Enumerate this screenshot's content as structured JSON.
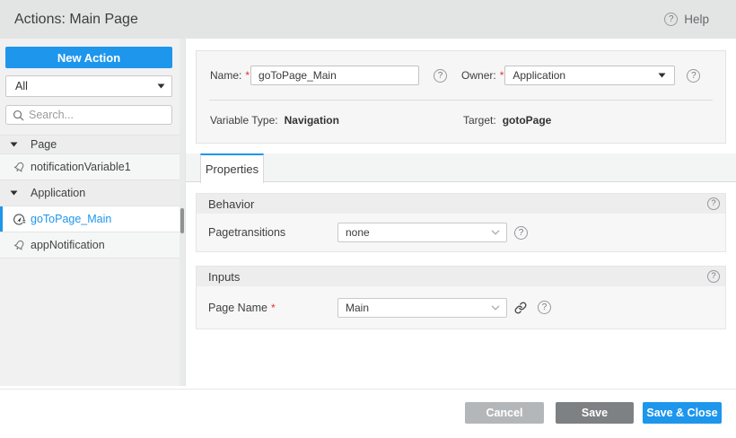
{
  "colors": {
    "accent_blue": "#1e96ec",
    "save_gray": "#7d8183",
    "cancel_gray": "#b4b7b9",
    "required_red": "#e5322d"
  },
  "header": {
    "title": "Actions: Main Page",
    "help_label": "Help"
  },
  "sidebar": {
    "new_action_label": "New Action",
    "filter_value": "All",
    "search_placeholder": "Search...",
    "tree": [
      {
        "label": "Page",
        "type": "group",
        "expanded": true
      },
      {
        "label": "notificationVariable1",
        "type": "notification",
        "selected": false
      },
      {
        "label": "Application",
        "type": "group",
        "expanded": true
      },
      {
        "label": "goToPage_Main",
        "type": "navigate",
        "selected": true
      },
      {
        "label": "appNotification",
        "type": "notification",
        "selected": false
      }
    ]
  },
  "form": {
    "name_label": "Name:",
    "name_value": "goToPage_Main",
    "owner_label": "Owner:",
    "owner_value": "Application",
    "variable_type_label": "Variable Type:",
    "variable_type_value": "Navigation",
    "target_label": "Target:",
    "target_value": "gotoPage"
  },
  "tabs": [
    {
      "label": "Properties",
      "active": true
    }
  ],
  "sections": [
    {
      "title": "Behavior",
      "row": {
        "label": "Pagetransitions",
        "required": false,
        "value": "none",
        "has_link": false
      }
    },
    {
      "title": "Inputs",
      "row": {
        "label": "Page Name",
        "required": true,
        "value": "Main",
        "has_link": true
      }
    }
  ],
  "footer": {
    "cancel_label": "Cancel",
    "save_label": "Save",
    "save_close_label": "Save & Close"
  }
}
